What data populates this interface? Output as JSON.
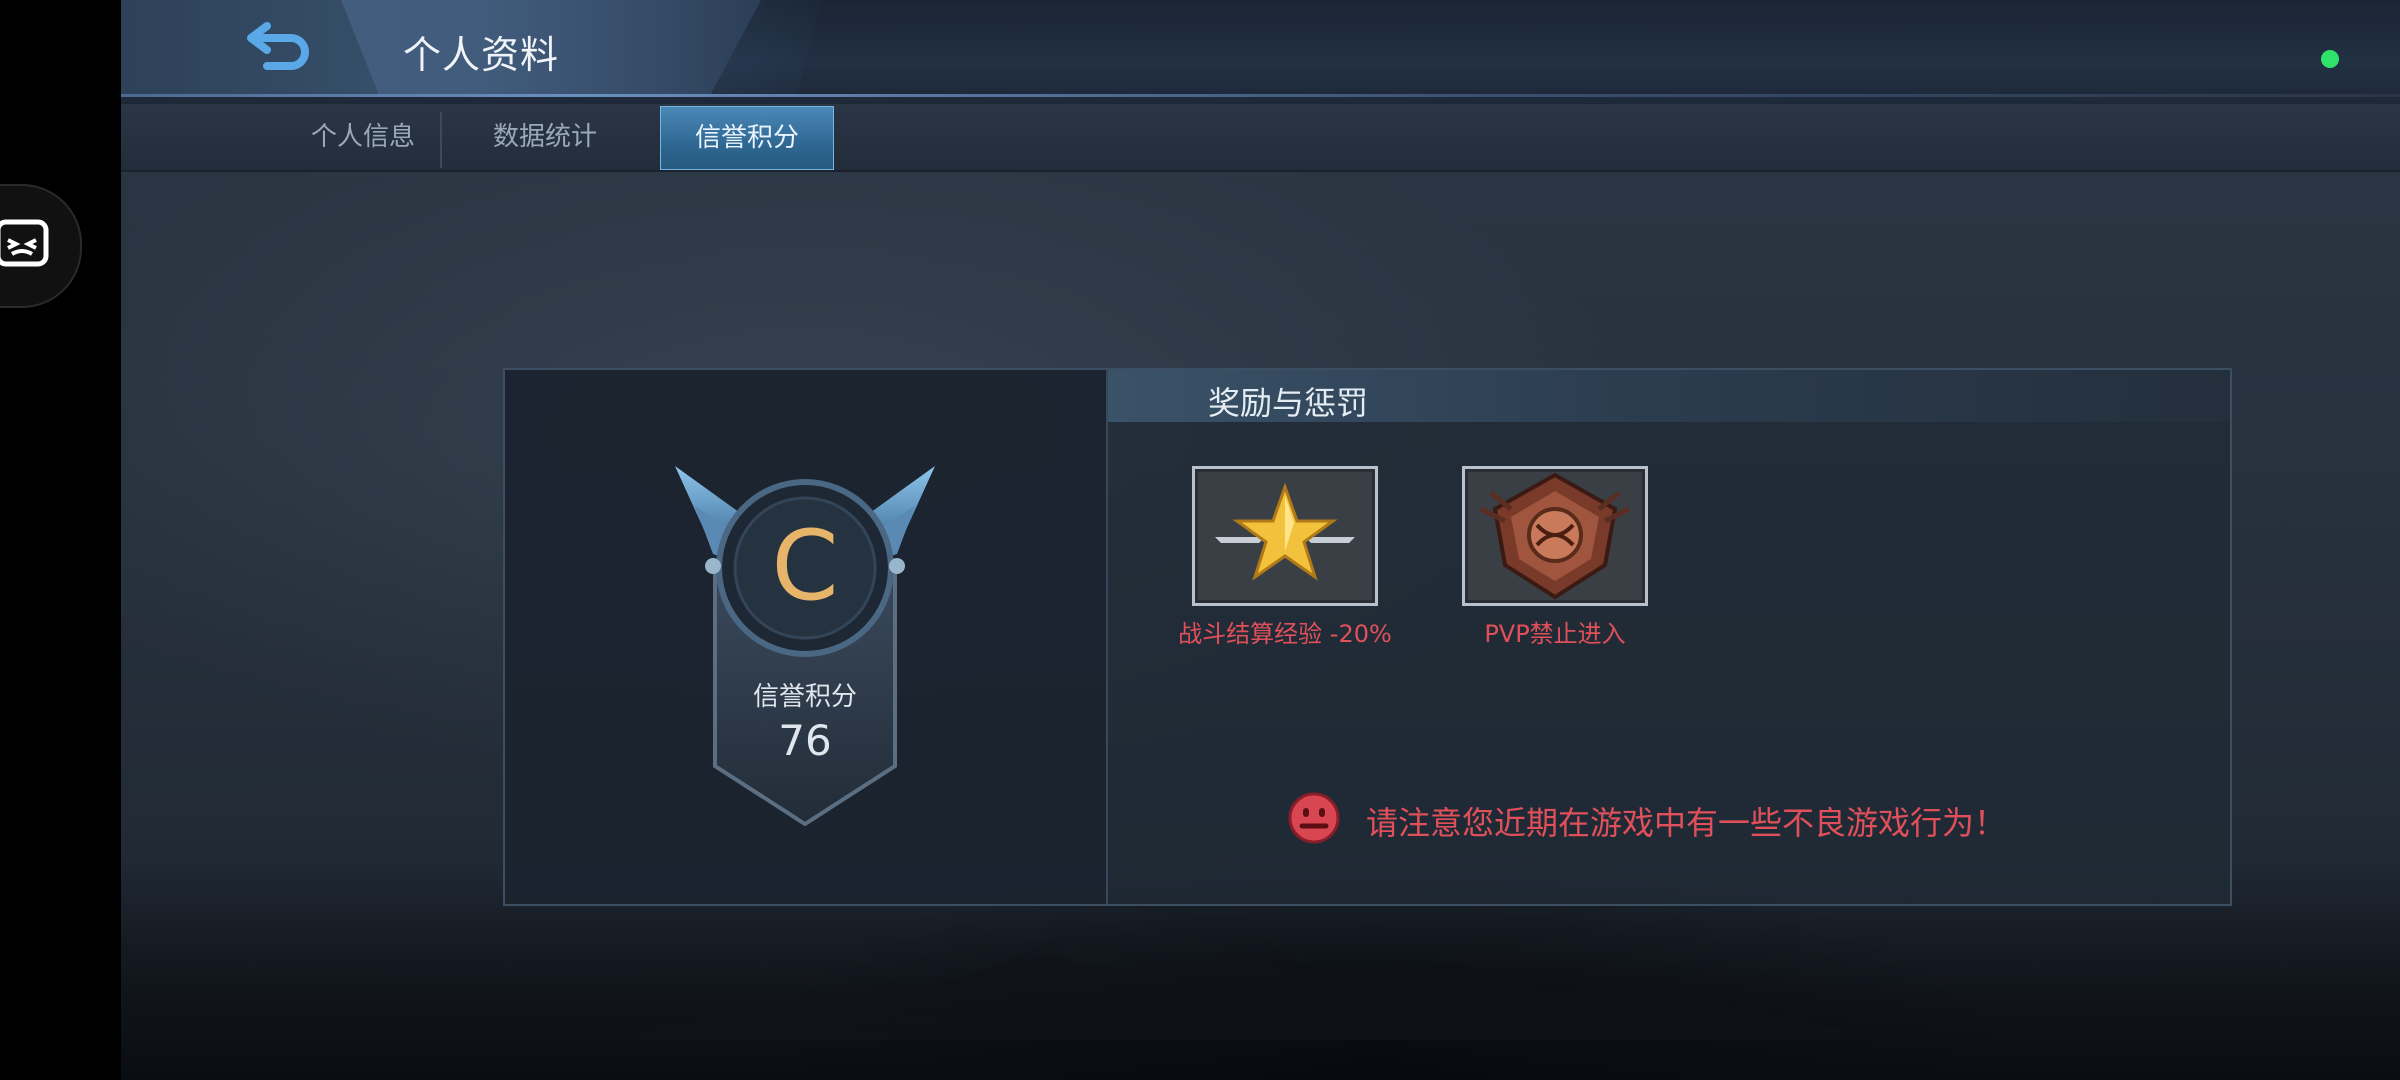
{
  "header": {
    "title": "个人资料",
    "back_icon": "back-arrow-icon",
    "status_color": "#2ee26a"
  },
  "tabs": [
    {
      "label": "个人信息",
      "active": false
    },
    {
      "label": "数据统计",
      "active": false
    },
    {
      "label": "信誉积分",
      "active": true
    }
  ],
  "credit": {
    "grade": "C",
    "label": "信誉积分",
    "score": "76"
  },
  "rewards": {
    "title": "奖励与惩罚",
    "items": [
      {
        "icon": "gold-star-icon",
        "label": "战斗结算经验 -20%"
      },
      {
        "icon": "pvp-ban-emblem-icon",
        "label": "PVP禁止进入"
      }
    ],
    "warning": {
      "icon": "frown-face-icon",
      "text": "请注意您近期在游戏中有一些不良游戏行为！"
    }
  },
  "colors": {
    "accent": "#4b88b8",
    "penalty": "#e0505a",
    "grade": "#e6b56a"
  }
}
